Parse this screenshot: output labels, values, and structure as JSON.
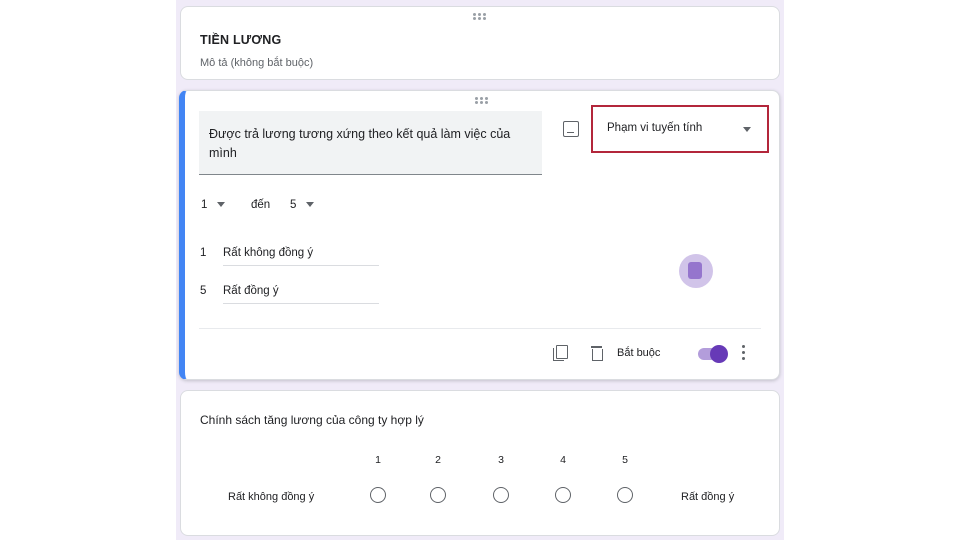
{
  "section": {
    "title": "TIỀN LƯƠNG",
    "description": "Mô tả (không bắt buộc)"
  },
  "question": {
    "text": "Được trả lương tương xứng theo kết quả làm việc của mình",
    "type_label": "Phạm vi tuyến tính",
    "range": {
      "from": "1",
      "to_word": "đến",
      "to": "5"
    },
    "low": {
      "num": "1",
      "label": "Rất không đồng ý"
    },
    "high": {
      "num": "5",
      "label": "Rất đồng ý"
    },
    "required_label": "Bắt buộc",
    "required": true,
    "icons": [
      "drag-handle-icon",
      "image-icon",
      "dropdown-caret-icon",
      "copy-icon",
      "delete-icon",
      "more-vert-icon",
      "addon-badge-icon"
    ]
  },
  "preview": {
    "title": "Chính sách tăng lương của công ty hợp lý",
    "scale": [
      "1",
      "2",
      "3",
      "4",
      "5"
    ],
    "low_label": "Rất không đồng ý",
    "high_label": "Rất đồng ý"
  },
  "colors": {
    "accent": "#673ab7",
    "active_border": "#4285f4",
    "highlight": "#b3263b",
    "background": "#f0ebf8"
  }
}
